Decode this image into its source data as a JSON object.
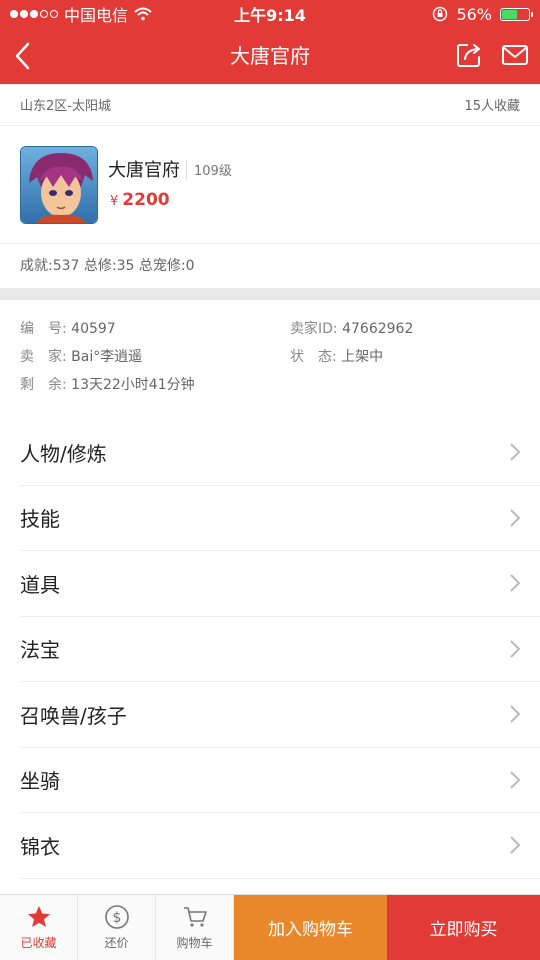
{
  "status_bar": {
    "carrier": "中国电信",
    "time": "上午9:14",
    "battery_percent": "56%",
    "battery_level": 0.56,
    "signal_bars_filled": 3,
    "signal_bars_total": 5
  },
  "nav": {
    "title": "大唐官府",
    "back_icon": "chevron-left-icon",
    "share_icon": "share-icon",
    "mail_icon": "mail-icon"
  },
  "server": {
    "location": "山东2区-太阳城",
    "favorites": "15人收藏"
  },
  "product": {
    "name": "大唐官府",
    "level": "109级",
    "currency": "¥",
    "price": "2200"
  },
  "stats": "成就:537 总修:35 总宠修:0",
  "info": {
    "id_label": "编　号:",
    "id_value": "40597",
    "seller_id_label": "卖家ID:",
    "seller_id_value": "47662962",
    "seller_label": "卖　家:",
    "seller_value": "Bai°李逍遥",
    "status_label": "状　态:",
    "status_value": "上架中",
    "remaining_label": "剩　余:",
    "remaining_value": "13天22小时41分钟"
  },
  "menu": [
    "人物/修炼",
    "技能",
    "道具",
    "法宝",
    "召唤兽/孩子",
    "坐骑",
    "锦衣"
  ],
  "tab_bar": {
    "favorite": "已收藏",
    "bargain": "还价",
    "cart": "购物车",
    "add_to_cart": "加入购物车",
    "buy_now": "立即购买"
  },
  "colors": {
    "accent": "#e23b37",
    "orange": "#e8882a"
  }
}
